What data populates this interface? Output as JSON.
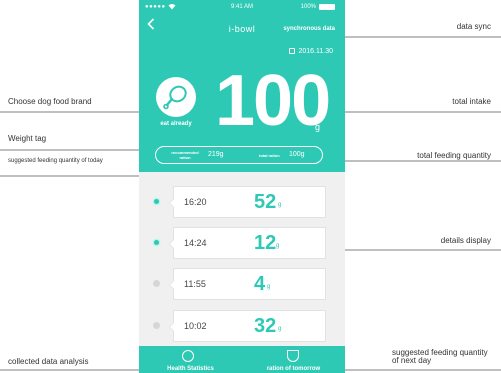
{
  "colors": {
    "teal": "#2ec9b5",
    "list_bg": "#f0f0f0"
  },
  "status_bar": {
    "signal": "●●●●●",
    "time": "9:41 AM",
    "battery_pct": "100%"
  },
  "nav": {
    "back_icon": "chevron-left-icon",
    "title": "i-bowl",
    "sync_label": "synchronous data"
  },
  "header": {
    "date": "2016.11.30",
    "brand_icon": "drumstick-icon",
    "eat_label": "eat already",
    "intake_value": "100",
    "intake_unit": "g"
  },
  "ration": {
    "recommended_label": "recommended ration",
    "recommended_value": "219g",
    "total_label": "total ration",
    "total_value": "100g"
  },
  "records": [
    {
      "time": "16:20",
      "amount": "52",
      "unit": "g",
      "active": true
    },
    {
      "time": "14:24",
      "amount": "12",
      "unit": "g",
      "active": true
    },
    {
      "time": "11:55",
      "amount": "4",
      "unit": "g",
      "active": false
    },
    {
      "time": "10:02",
      "amount": "32",
      "unit": "g",
      "active": false
    }
  ],
  "tabbar": {
    "tabs": [
      {
        "label": "Health Statistics",
        "icon": "pie-chart-icon"
      },
      {
        "label": "ration of tomorrow",
        "icon": "bowl-icon"
      }
    ]
  },
  "annotations": {
    "data_sync": "data sync",
    "choose_brand": "Choose dog food brand",
    "total_intake": "total intake",
    "weight_tag": "Weight tag",
    "suggested_today": "suggested feeding quantity of today",
    "total_feeding": "total feeding quantity",
    "details_display": "details display",
    "collected_analysis": "collected data analysis",
    "suggested_next_day": "suggested feeding quantity of next day"
  }
}
